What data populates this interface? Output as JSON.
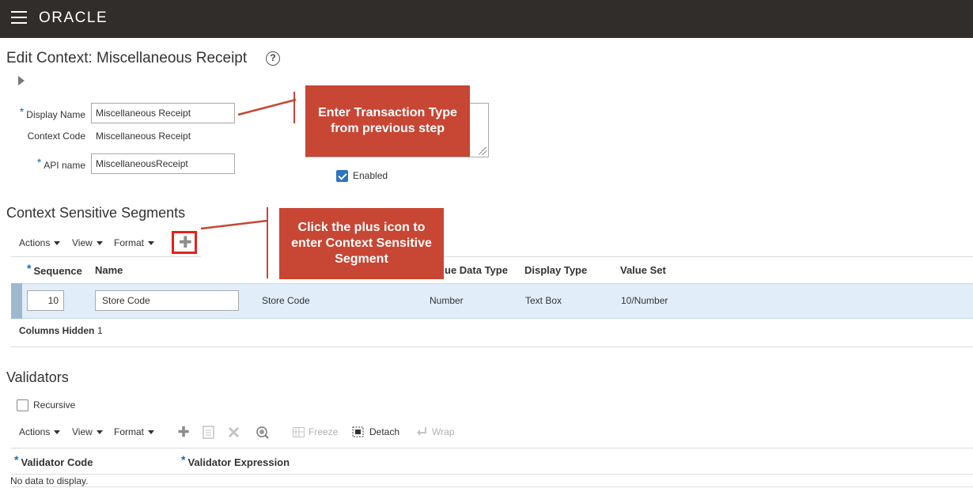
{
  "header": {
    "logo": "ORACLE"
  },
  "page": {
    "title": "Edit Context: Miscellaneous Receipt",
    "help": "?"
  },
  "form": {
    "required_mark": "*",
    "display_name_label": "Display Name",
    "display_name_value": "Miscellaneous Receipt",
    "context_code_label": "Context Code",
    "context_code_value": "Miscellaneous Receipt",
    "api_name_label": "API name",
    "api_name_value": "MiscellaneousReceipt",
    "enabled_label": "Enabled",
    "enabled_checked": true
  },
  "callouts": {
    "transaction": "Enter Transaction Type from previous step",
    "plus": "Click the plus icon  to enter Context Sensitive Segment"
  },
  "segments": {
    "title": "Context Sensitive Segments",
    "toolbar": {
      "actions": "Actions",
      "view": "View",
      "format": "Format",
      "add": "✚"
    },
    "columns": {
      "sequence": "Sequence",
      "name": "Name",
      "value_data_type": "ue Data Type",
      "display_type": "Display Type",
      "value_set": "Value Set"
    },
    "rows": [
      {
        "sequence": "10",
        "name": "Store Code",
        "code": "Store Code",
        "value_data_type": "Number",
        "display_type": "Text Box",
        "value_set": "10/Number"
      }
    ],
    "columns_hidden_label": "Columns Hidden",
    "columns_hidden_value": "1"
  },
  "validators": {
    "title": "Validators",
    "recursive_label": "Recursive",
    "toolbar": {
      "actions": "Actions",
      "view": "View",
      "format": "Format",
      "freeze": "Freeze",
      "detach": "Detach",
      "wrap": "Wrap"
    },
    "columns": {
      "validator_code": "Validator Code",
      "validator_expression": "Validator Expression"
    },
    "empty_text": "No data to display."
  },
  "colors": {
    "header_bg": "#312d2a",
    "callout_bg": "#c74634",
    "highlight": "#e2231a",
    "selected_row": "#e1eef9"
  }
}
